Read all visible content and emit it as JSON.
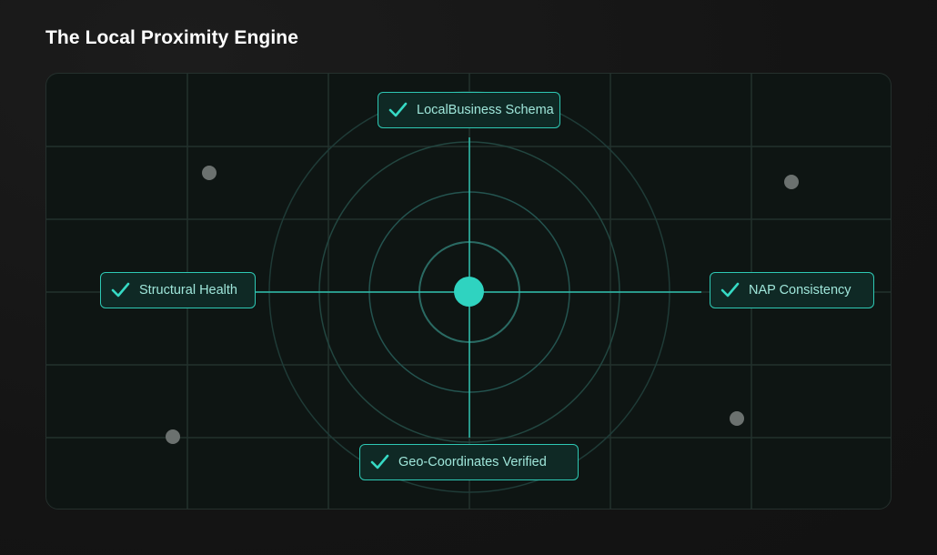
{
  "page": {
    "title": "The Local Proximity Engine"
  },
  "diagram": {
    "center_node": "center-dot",
    "nodes": {
      "top": {
        "label": "LocalBusiness Schema",
        "status": "verified",
        "icon": "check-icon"
      },
      "left": {
        "label": "Structural Health",
        "status": "verified",
        "icon": "check-icon"
      },
      "right": {
        "label": "NAP Consistency",
        "status": "verified",
        "icon": "check-icon"
      },
      "bottom": {
        "label": "Geo-Coordinates Verified",
        "status": "verified",
        "icon": "check-icon"
      }
    },
    "rings": 4,
    "background_points": 4
  },
  "colors": {
    "background": "#141414",
    "panel": "#0e1513",
    "accent": "#2fd3c0",
    "node_fill": "#0f2925",
    "node_text": "#9fe6da",
    "grid": "#23332f",
    "point": "#6b716f"
  }
}
